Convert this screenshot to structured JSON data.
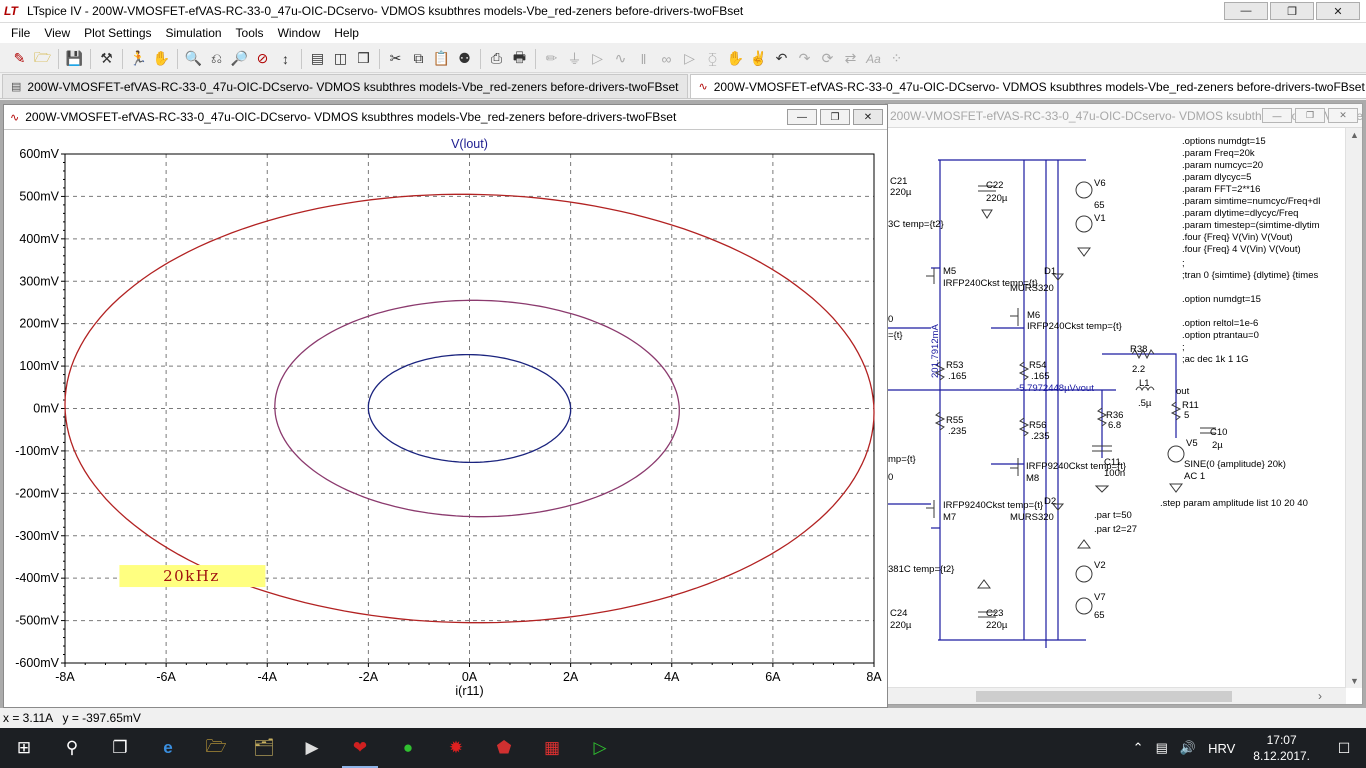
{
  "app": {
    "title": "LTspice IV - 200W-VMOSFET-efVAS-RC-33-0_47u-OIC-DCservo- VDMOS ksubthres models-Vbe_red-zeners before-drivers-twoFBset",
    "logo": "LT"
  },
  "menu": [
    "File",
    "View",
    "Plot Settings",
    "Simulation",
    "Tools",
    "Window",
    "Help"
  ],
  "toolbar": [
    "new-schematic-icon",
    "open-icon",
    "save-icon",
    "control-panel-icon",
    "run-icon",
    "pan-icon",
    "zoom-in-icon",
    "zoom-back-icon",
    "zoom-out-icon",
    "zoom-cancel-icon",
    "autorange-icon",
    "tile-horizontal-icon",
    "tile-vertical-icon",
    "cascade-icon",
    "cut-icon",
    "copy-icon",
    "paste-icon",
    "find-icon",
    "print-preview-icon",
    "print-icon",
    "wire-icon",
    "ground-icon",
    "label-icon",
    "resistor-icon",
    "capacitor-icon",
    "inductor-icon",
    "diode-icon",
    "component-icon",
    "move-icon",
    "drag-icon",
    "undo-icon",
    "redo-icon",
    "rotate-icon",
    "mirror-icon",
    "text-icon",
    "spice-directive-icon"
  ],
  "tabs": [
    {
      "label": "200W-VMOSFET-efVAS-RC-33-0_47u-OIC-DCservo- VDMOS ksubthres models-Vbe_red-zeners before-drivers-twoFBset",
      "kind": "schematic"
    },
    {
      "label": "200W-VMOSFET-efVAS-RC-33-0_47u-OIC-DCservo- VDMOS ksubthres models-Vbe_red-zeners before-drivers-twoFBset",
      "kind": "plot"
    }
  ],
  "plot_window": {
    "title": "200W-VMOSFET-efVAS-RC-33-0_47u-OIC-DCservo- VDMOS ksubthres models-Vbe_red-zeners before-drivers-twoFBset",
    "annotation": "20kHz",
    "colors": {
      "series1": "#b22222",
      "series2": "#8b3a6e",
      "series3": "#1a237e",
      "annotation_bg": "#ffff80"
    }
  },
  "chart_data": {
    "type": "line",
    "title": "V(lout)",
    "xlabel": "i(r11)",
    "ylabel": "",
    "xlim": [
      -8,
      8
    ],
    "ylim": [
      -600,
      600
    ],
    "xticks": [
      "-8A",
      "-6A",
      "-4A",
      "-2A",
      "0A",
      "2A",
      "4A",
      "6A",
      "8A"
    ],
    "yticks": [
      "600mV",
      "500mV",
      "400mV",
      "300mV",
      "200mV",
      "100mV",
      "0mV",
      "-100mV",
      "-200mV",
      "-300mV",
      "-400mV",
      "-500mV",
      "-600mV"
    ],
    "grid": true,
    "series": [
      {
        "color": "#b22222",
        "cx": 0,
        "cy": 0,
        "rx": 8.0,
        "ry": 505,
        "tilt_deg": -3
      },
      {
        "color": "#8b3a6e",
        "cx": 0.15,
        "cy": 0,
        "rx": 4.0,
        "ry": 255,
        "tilt_deg": -3
      },
      {
        "color": "#1a237e",
        "cx": 0.0,
        "cy": 0,
        "rx": 2.0,
        "ry": 127,
        "tilt_deg": -3
      }
    ]
  },
  "schematic_window": {
    "title": "200W-VMOSFET-efVAS-RC-33-0_47u-OIC-DCservo- VDMOS ksubthres models-Vbe_red-zeners before..."
  },
  "schematic": {
    "labels": [
      {
        "text": "C21"
      },
      {
        "text": "220µ"
      },
      {
        "text": "C22"
      },
      {
        "text": "220µ"
      },
      {
        "text": "V6"
      },
      {
        "text": "65"
      },
      {
        "text": "V1"
      },
      {
        "text": "3C temp={t2}"
      },
      {
        "text": "M5"
      },
      {
        "text": "IRFP240Ckst temp={t}"
      },
      {
        "text": "D1"
      },
      {
        "text": "MURS320"
      },
      {
        "text": "M6"
      },
      {
        "text": "IRFP240Ckst temp={t}"
      },
      {
        "text": "201.7912mA"
      },
      {
        "text": "R53"
      },
      {
        "text": ".165"
      },
      {
        "text": "R54"
      },
      {
        "text": ".165"
      },
      {
        "text": "-5.7972448µVvout"
      },
      {
        "text": "R38"
      },
      {
        "text": "2.2"
      },
      {
        "text": "L1"
      },
      {
        "text": ".5µ"
      },
      {
        "text": "out"
      },
      {
        "text": "R11"
      },
      {
        "text": "5"
      },
      {
        "text": "R36"
      },
      {
        "text": "6.8"
      },
      {
        "text": "R55"
      },
      {
        "text": ".235"
      },
      {
        "text": "R56"
      },
      {
        "text": ".235"
      },
      {
        "text": "C10"
      },
      {
        "text": "2µ"
      },
      {
        "text": "V5"
      },
      {
        "text": "C11"
      },
      {
        "text": "100n"
      },
      {
        "text": "IRFP9240Ckst temp={t}"
      },
      {
        "text": "M8"
      },
      {
        "text": "SINE(0 {amplitude} 20k)"
      },
      {
        "text": "AC 1"
      },
      {
        "text": "IRFP9240Ckst temp={t}"
      },
      {
        "text": "D2"
      },
      {
        "text": "M7"
      },
      {
        "text": "MURS320"
      },
      {
        "text": ".step param amplitude list 10 20 40"
      },
      {
        "text": ".par t=50"
      },
      {
        "text": ".par t2=27"
      },
      {
        "text": "381C temp={t2}"
      },
      {
        "text": "V2"
      },
      {
        "text": "V7"
      },
      {
        "text": "65"
      },
      {
        "text": "C24"
      },
      {
        "text": "220µ"
      },
      {
        "text": "C23"
      },
      {
        "text": "220µ"
      },
      {
        "text": "0"
      },
      {
        "text": "0"
      },
      {
        "text": "mp={t}"
      },
      {
        "text": "={t}"
      }
    ],
    "directives": [
      ".options numdgt=15",
      ".param Freq=20k",
      ".param numcyc=20",
      ".param dlycyc=5",
      ".param FFT=2**16",
      ".param simtime=numcyc/Freq+dl",
      ".param dlytime=dlycyc/Freq",
      ".param timestep=(simtime-dlytim",
      ".four {Freq} V(Vin) V(Vout)",
      ".four {Freq} 4 V(Vin) V(Vout)",
      ";",
      ";tran 0 {simtime} {dlytime} {times",
      "",
      ".option numdgt=15",
      "",
      ".option reltol=1e-6",
      ".option ptrantau=0",
      ";",
      ";ac dec 1k 1 1G"
    ]
  },
  "status": {
    "x": "x = 3.11A",
    "y": "y = -397.65mV"
  },
  "taskbar": {
    "apps": [
      "start-icon",
      "search-icon",
      "task-view-icon",
      "edge-icon",
      "file-explorer-icon",
      "folder-icon",
      "media-icon",
      "ltspice-icon",
      "network-app-icon",
      "pcb-app-icon",
      "gem-app-icon",
      "pdf-icon",
      "wave-app-icon"
    ],
    "tray": [
      "chevron-up-icon",
      "network-icon",
      "volume-icon",
      "language-label"
    ],
    "language": "HRV",
    "time": "17:07",
    "date": "8.12.2017."
  }
}
